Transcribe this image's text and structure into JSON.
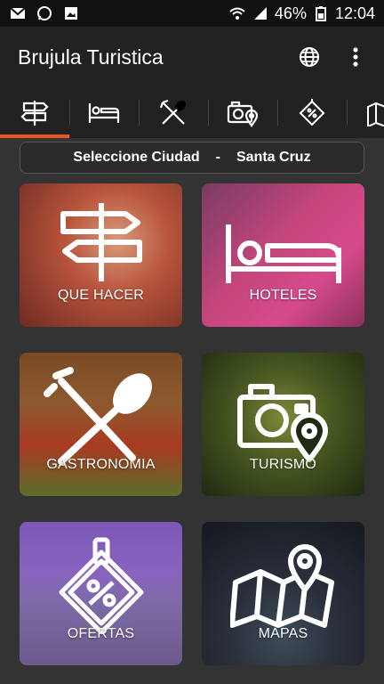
{
  "status_bar": {
    "battery_percent": "46%",
    "time": "12:04"
  },
  "app_bar": {
    "title": "Brujula Turistica"
  },
  "tabs": [
    {
      "icon": "signpost-icon",
      "active": true
    },
    {
      "icon": "bed-icon",
      "active": false
    },
    {
      "icon": "utensils-icon",
      "active": false
    },
    {
      "icon": "camera-pin-icon",
      "active": false
    },
    {
      "icon": "tag-percent-icon",
      "active": false
    },
    {
      "icon": "map-icon",
      "active": false
    }
  ],
  "city_selector": {
    "prefix": "Seleccione Ciudad",
    "separator": "-",
    "city": "Santa Cruz"
  },
  "tiles": [
    {
      "label": "QUE HACER",
      "icon": "signpost-icon"
    },
    {
      "label": "HOTELES",
      "icon": "bed-icon"
    },
    {
      "label": "GASTRONOMIA",
      "icon": "utensils-icon"
    },
    {
      "label": "TURISMO",
      "icon": "camera-pin-icon"
    },
    {
      "label": "OFERTAS",
      "icon": "tag-percent-icon"
    },
    {
      "label": "MAPAS",
      "icon": "map-pin-icon"
    }
  ],
  "colors": {
    "accent": "#e8571e",
    "background": "#333333",
    "toolbar": "#212121"
  }
}
